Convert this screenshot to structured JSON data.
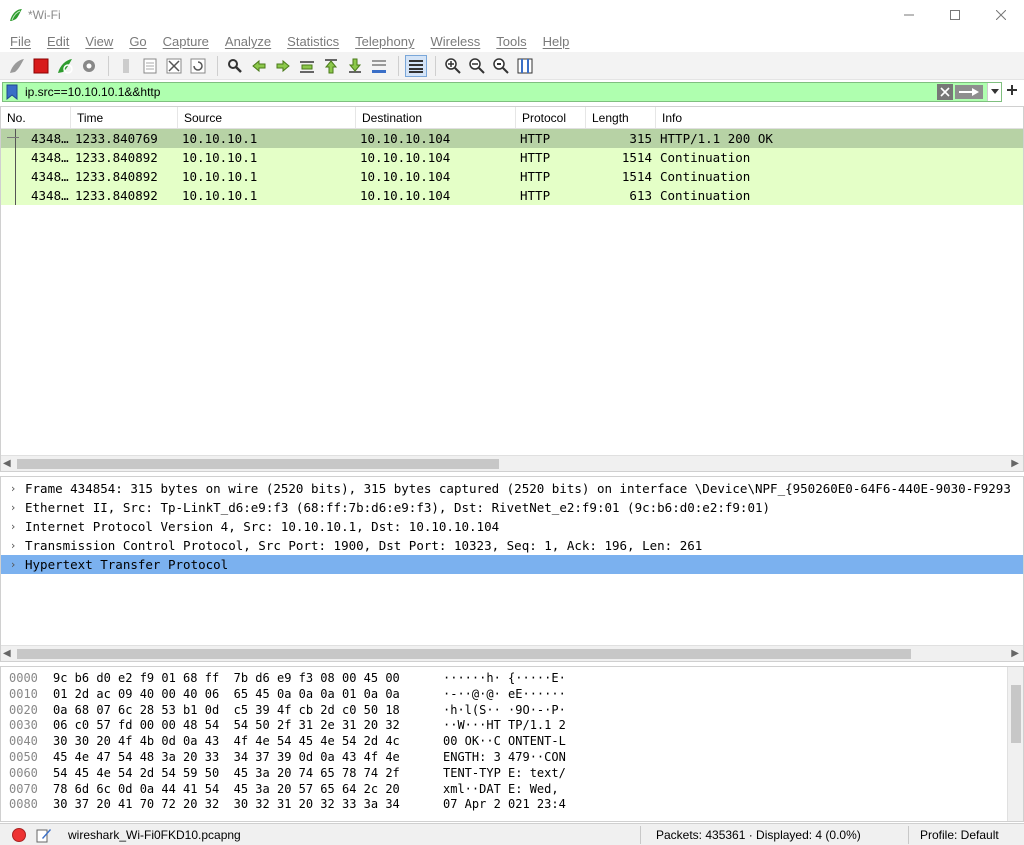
{
  "window": {
    "title": "*Wi-Fi"
  },
  "menu": [
    "File",
    "Edit",
    "View",
    "Go",
    "Capture",
    "Analyze",
    "Statistics",
    "Telephony",
    "Wireless",
    "Tools",
    "Help"
  ],
  "filter": {
    "value": "ip.src==10.10.10.1&&http"
  },
  "columns": [
    "No.",
    "Time",
    "Source",
    "Destination",
    "Protocol",
    "Length",
    "Info"
  ],
  "packets": [
    {
      "no": "4348…",
      "time": "1233.840769",
      "source": "10.10.10.1",
      "destination": "10.10.10.104",
      "protocol": "HTTP",
      "length": "315",
      "info": "HTTP/1.1 200 OK"
    },
    {
      "no": "4348…",
      "time": "1233.840892",
      "source": "10.10.10.1",
      "destination": "10.10.10.104",
      "protocol": "HTTP",
      "length": "1514",
      "info": "Continuation"
    },
    {
      "no": "4348…",
      "time": "1233.840892",
      "source": "10.10.10.1",
      "destination": "10.10.10.104",
      "protocol": "HTTP",
      "length": "1514",
      "info": "Continuation"
    },
    {
      "no": "4348…",
      "time": "1233.840892",
      "source": "10.10.10.1",
      "destination": "10.10.10.104",
      "protocol": "HTTP",
      "length": "613",
      "info": "Continuation"
    }
  ],
  "details": [
    "Frame 434854: 315 bytes on wire (2520 bits), 315 bytes captured (2520 bits) on interface \\Device\\NPF_{950260E0-64F6-440E-9030-F9293",
    "Ethernet II, Src: Tp-LinkT_d6:e9:f3 (68:ff:7b:d6:e9:f3), Dst: RivetNet_e2:f9:01 (9c:b6:d0:e2:f9:01)",
    "Internet Protocol Version 4, Src: 10.10.10.1, Dst: 10.10.10.104",
    "Transmission Control Protocol, Src Port: 1900, Dst Port: 10323, Seq: 1, Ack: 196, Len: 261",
    "Hypertext Transfer Protocol"
  ],
  "bytes": [
    {
      "offset": "0000",
      "hex": "9c b6 d0 e2 f9 01 68 ff  7b d6 e9 f3 08 00 45 00",
      "ascii": "······h· {·····E·"
    },
    {
      "offset": "0010",
      "hex": "01 2d ac 09 40 00 40 06  65 45 0a 0a 0a 01 0a 0a",
      "ascii": "·-··@·@· eE······"
    },
    {
      "offset": "0020",
      "hex": "0a 68 07 6c 28 53 b1 0d  c5 39 4f cb 2d c0 50 18",
      "ascii": "·h·l(S·· ·9O·-·P·"
    },
    {
      "offset": "0030",
      "hex": "06 c0 57 fd 00 00 48 54  54 50 2f 31 2e 31 20 32",
      "ascii": "··W···HT TP/1.1 2"
    },
    {
      "offset": "0040",
      "hex": "30 30 20 4f 4b 0d 0a 43  4f 4e 54 45 4e 54 2d 4c",
      "ascii": "00 OK··C ONTENT-L"
    },
    {
      "offset": "0050",
      "hex": "45 4e 47 54 48 3a 20 33  34 37 39 0d 0a 43 4f 4e",
      "ascii": "ENGTH: 3 479··CON"
    },
    {
      "offset": "0060",
      "hex": "54 45 4e 54 2d 54 59 50  45 3a 20 74 65 78 74 2f",
      "ascii": "TENT-TYP E: text/"
    },
    {
      "offset": "0070",
      "hex": "78 6d 6c 0d 0a 44 41 54  45 3a 20 57 65 64 2c 20",
      "ascii": "xml··DAT E: Wed, "
    },
    {
      "offset": "0080",
      "hex": "30 37 20 41 70 72 20 32  30 32 31 20 32 33 3a 34",
      "ascii": "07 Apr 2 021 23:4"
    }
  ],
  "status": {
    "file": "wireshark_Wi-Fi0FKD10.pcapng",
    "packets": "Packets: 435361 · Displayed: 4 (0.0%)",
    "profile": "Profile: Default"
  },
  "colors": {
    "filter_valid": "#afffaf",
    "http_row": "#e4ffc7",
    "selected_row": "#b7d2a5",
    "selected_detail": "#7bb1ef"
  }
}
